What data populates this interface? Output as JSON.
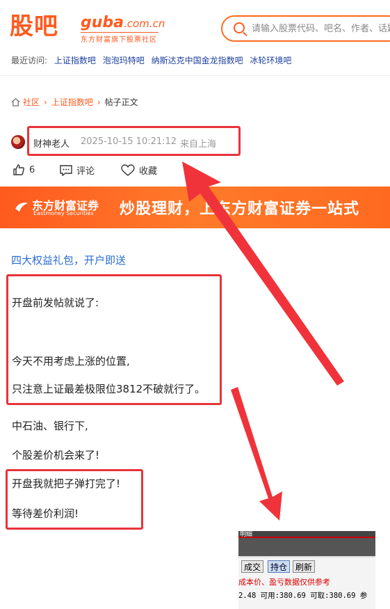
{
  "header": {
    "logo_cn": "股吧",
    "logo_en": "guba",
    "logo_domain": ".com.cn",
    "logo_tagline": "东方财富旗下股票社区",
    "search_placeholder": "请输入股票代码、吧名、作者、话题",
    "recent_label": "最近访问:",
    "recent_items": [
      "上证指数吧",
      "泡泡玛特吧",
      "纳斯达克中国金龙指数吧",
      "冰轮环境吧"
    ]
  },
  "breadcrumb": {
    "items": [
      "社区",
      "上证指数吧",
      "帖子正文"
    ]
  },
  "post": {
    "author": "财神老人",
    "time": "2025-10-15 10:21:12",
    "location": "来自上海",
    "actions": {
      "like_count": "6",
      "comment_label": "评论",
      "favorite_label": "收藏"
    }
  },
  "banner": {
    "brand_cn": "东方财富证券",
    "brand_en": "Eastmoney Securities",
    "slogan": "炒股理财，上东方财富证券一站式"
  },
  "promo_link": "四大权益礼包，开户即送",
  "content": {
    "p1": "开盘前发帖就说了:",
    "p2": "今天不用考虑上涨的位置,",
    "p3": "只注意上证最差极限位3812不破就行了。",
    "p4": "中石油、银行下,",
    "p5": "个股差价机会来了!",
    "p6": "开盘我就把子弹打完了!",
    "p7": "等待差价利润!"
  },
  "inset": {
    "top_label": "明细",
    "buttons": [
      "成交",
      "持仓",
      "刷新"
    ],
    "note": "成本价、盈亏数据仅供参考",
    "numbers": "2.48  可用:380.69  可取:380.69  参"
  },
  "colors": {
    "accent": "#ff5a1f",
    "highlight_red": "#e8333a",
    "link_blue": "#2a6bd0"
  }
}
